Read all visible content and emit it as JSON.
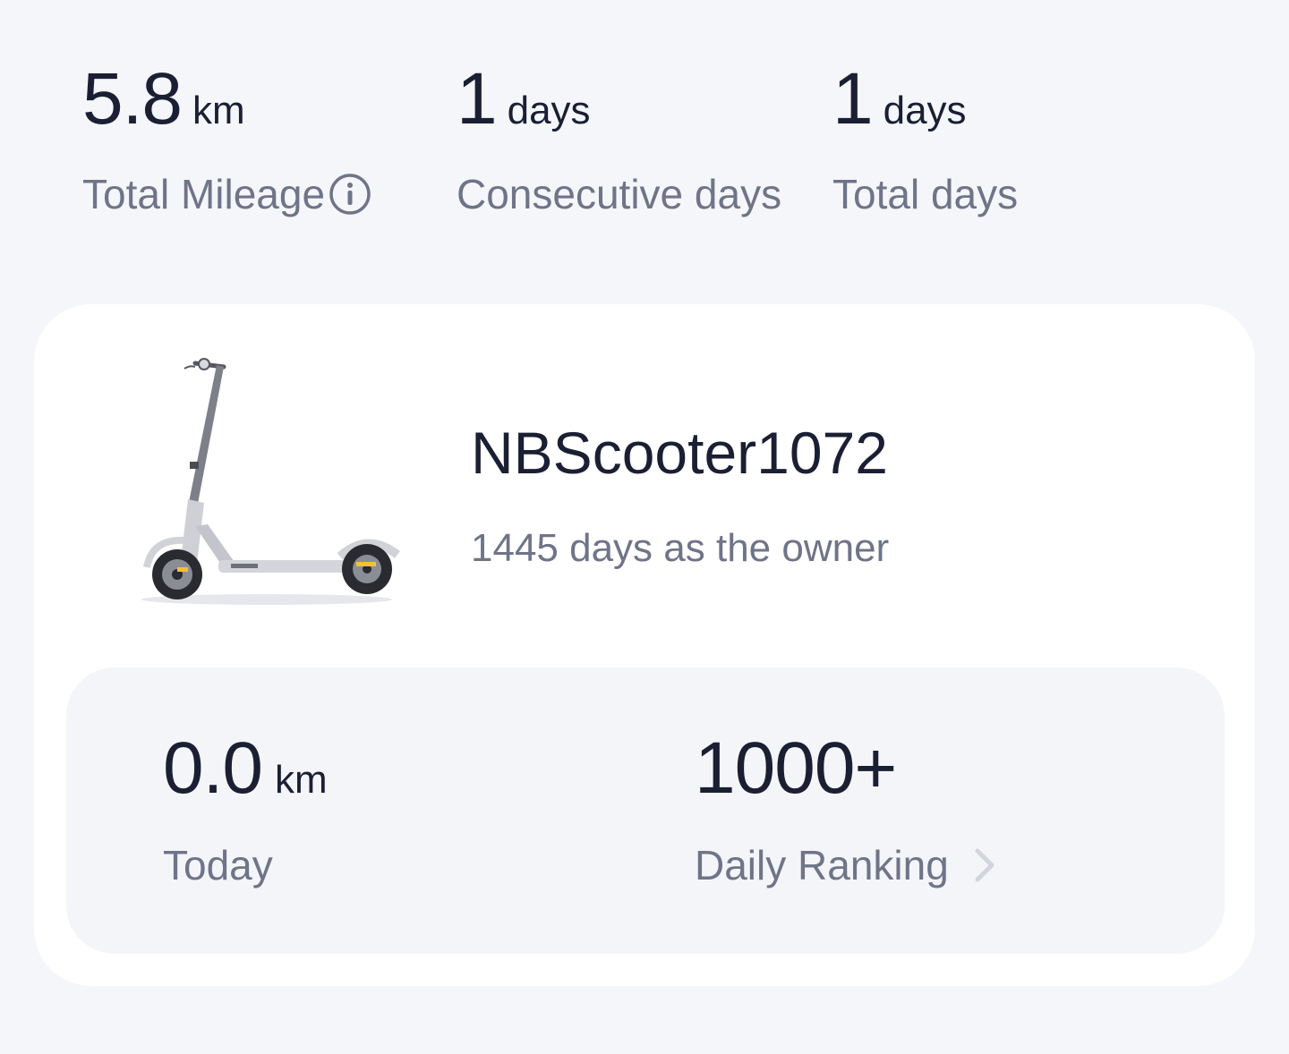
{
  "stats": {
    "mileage": {
      "value": "5.8",
      "unit": "km",
      "label": "Total Mileage"
    },
    "consecutive": {
      "value": "1",
      "unit": "days",
      "label": "Consecutive days"
    },
    "total": {
      "value": "1",
      "unit": "days",
      "label": "Total days"
    }
  },
  "device": {
    "name": "NBScooter1072",
    "owner_text": "1445 days as the owner"
  },
  "today": {
    "value": "0.0",
    "unit": "km",
    "label": "Today"
  },
  "ranking": {
    "value": "1000+",
    "label": "Daily Ranking"
  },
  "icons": {
    "info": "info-icon",
    "chevron": "chevron-right-icon"
  },
  "colors": {
    "background": "#f5f6fa",
    "card": "#ffffff",
    "panel": "#f4f5f9",
    "primary_text": "#1b1f33",
    "secondary_text": "#6f7488",
    "accent_yellow": "#f2c230"
  }
}
